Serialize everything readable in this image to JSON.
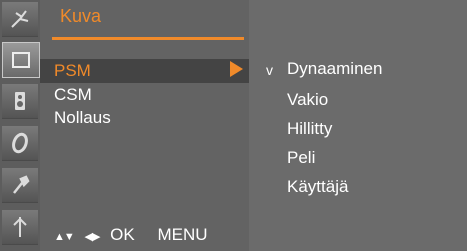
{
  "menu": {
    "title": "Kuva",
    "items": [
      {
        "label": "PSM",
        "selected": true
      },
      {
        "label": "CSM",
        "selected": false
      },
      {
        "label": "Nollaus",
        "selected": false
      }
    ]
  },
  "options": {
    "check_mark": "v",
    "items": [
      "Dynaaminen",
      "Vakio",
      "Hillitty",
      "Peli",
      "Käyttäjä"
    ],
    "selected_index": 0
  },
  "footer": {
    "updown_glyph": "▲▼",
    "leftright_glyph": "◀▶",
    "ok_label": "OK",
    "menu_label": "MENU"
  },
  "icons": [
    "antenna-icon",
    "picture-icon",
    "speaker-icon",
    "clock-icon",
    "wrench-icon",
    "input-icon"
  ],
  "colors": {
    "accent": "#f08a2a",
    "panel": "#636363",
    "text": "#ffffff"
  }
}
